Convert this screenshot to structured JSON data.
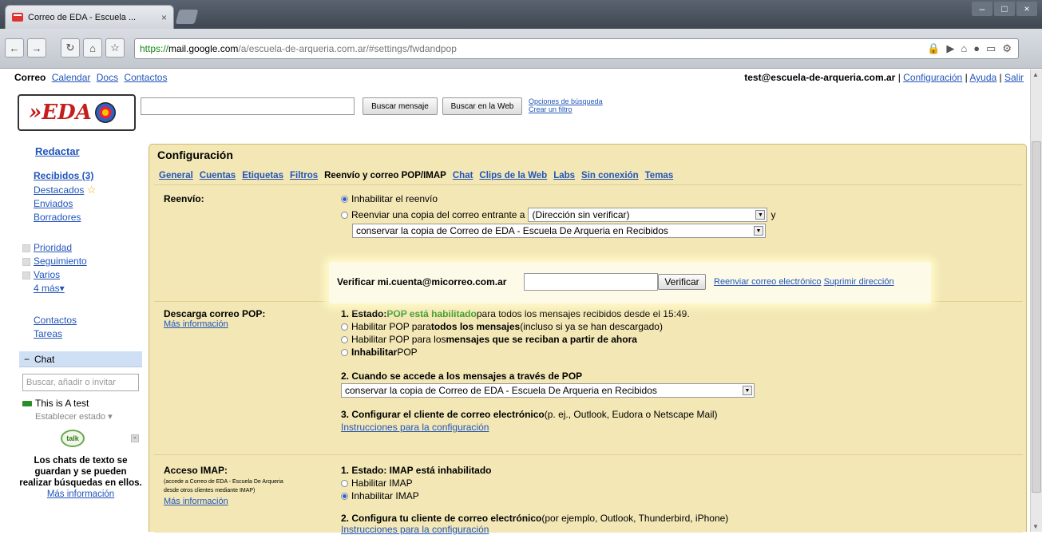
{
  "browser": {
    "tab_title": "Correo de EDA - Escuela ...",
    "url_https": "https://",
    "url_host": "mail.google.com",
    "url_rest": "/a/escuela-de-arqueria.com.ar/#settings/fwdandpop"
  },
  "topnav": {
    "mail": "Correo",
    "calendar": "Calendar",
    "docs": "Docs",
    "contacts": "Contactos",
    "account": "test@escuela-de-arqueria.com.ar",
    "settings": "Configuración",
    "help": "Ayuda",
    "signout": "Salir",
    "sep": "|"
  },
  "logo_text": "»EDA",
  "search": {
    "mail_button": "Buscar mensaje",
    "web_button": "Buscar en la Web",
    "options_link": "Opciones de búsqueda",
    "filter_link": "Crear un filtro"
  },
  "sidebar": {
    "compose": "Redactar",
    "inbox": "Recibidos (3)",
    "starred": "Destacados",
    "sent": "Enviados",
    "drafts": "Borradores",
    "labels": [
      "Prioridad",
      "Seguimiento",
      "Varios"
    ],
    "more": "4 más▾",
    "contacts": "Contactos",
    "tasks": "Tareas"
  },
  "chat": {
    "header": "Chat",
    "collapse": "−",
    "search_placeholder": "Buscar, añadir o invitar",
    "user": "This is A test",
    "status": "Establecer estado",
    "talk_icon": "talk",
    "info_text": "Los chats de texto se guardan y se pueden realizar búsquedas en ellos.",
    "info_link": "Más información"
  },
  "settings": {
    "title": "Configuración",
    "tabs": [
      "General",
      "Cuentas",
      "Etiquetas",
      "Filtros",
      "Reenvío y correo POP/IMAP",
      "Chat",
      "Clips de la Web",
      "Labs",
      "Sin conexión",
      "Temas"
    ],
    "active_tab": "Reenvío y correo POP/IMAP",
    "forwarding": {
      "label": "Reenvío:",
      "disable": "Inhabilitar el reenvío",
      "forward_copy": "Reenviar una copia del correo entrante a",
      "address_select": "(Dirección sin verificar)",
      "and": "y",
      "keep_select": "conservar la copia de Correo de EDA - Escuela De Arqueria en Recibidos",
      "verify_label": "Verificar mi.cuenta@micorreo.com.ar",
      "verify_button": "Verificar",
      "resend_link": "Reenviar correo electrónico",
      "remove_link": "Suprimir dirección"
    },
    "pop": {
      "label": "Descarga correo POP:",
      "more_info": "Más información",
      "status_prefix": "1. Estado: ",
      "status_value": "POP está habilitado",
      "status_suffix": " para todos los mensajes recibidos desde el 15:49.",
      "opt_all_a": "Habilitar POP para ",
      "opt_all_b": "todos los mensajes",
      "opt_all_c": " (incluso si ya se han descargado)",
      "opt_now_a": "Habilitar POP para los ",
      "opt_now_b": "mensajes que se reciban a partir de ahora",
      "opt_off_a": "Inhabilitar",
      "opt_off_b": " POP",
      "when_heading": "2. Cuando se accede a los mensajes a través de POP",
      "when_select": "conservar la copia de Correo de EDA - Escuela De Arqueria en Recibidos",
      "config_heading": "3. Configurar el cliente de correo electrónico",
      "config_suffix": " (p. ej., Outlook, Eudora o Netscape Mail)",
      "config_link": "Instrucciones para la configuración"
    },
    "imap": {
      "label": "Acceso IMAP:",
      "desc1": "(accede a Correo de EDA - Escuela De Arqueria",
      "desc2": "desde otros clientes mediante IMAP)",
      "more_info": "Más información",
      "status": "1. Estado: IMAP está inhabilitado",
      "enable": "Habilitar IMAP",
      "disable": "Inhabilitar IMAP",
      "client_heading": "2. Configura tu cliente de correo electrónico",
      "client_suffix": " (por ejemplo, Outlook, Thunderbird, iPhone)",
      "client_link": "Instrucciones para la configuración"
    }
  }
}
